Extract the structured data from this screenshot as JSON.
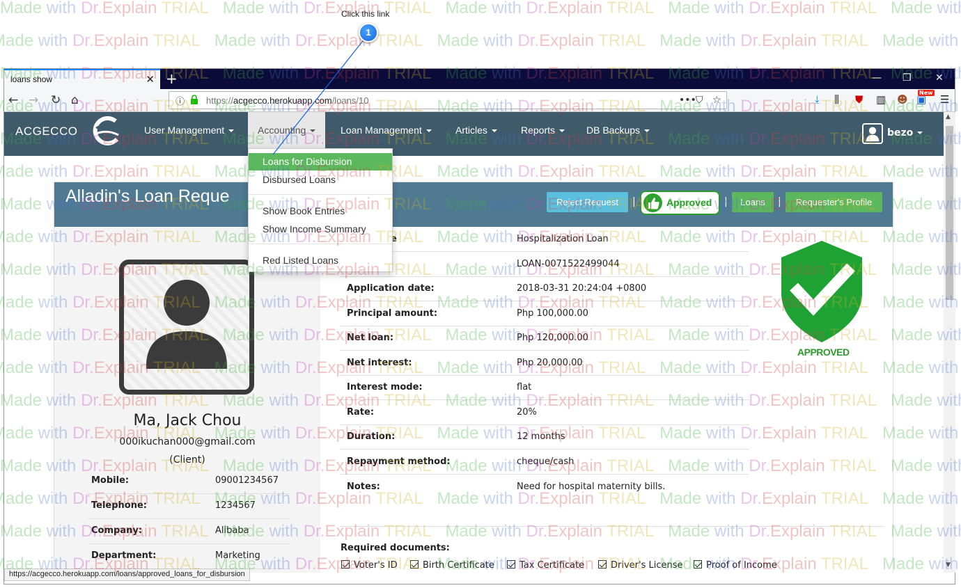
{
  "callout": {
    "text": "Click this link",
    "number": "1"
  },
  "watermark": {
    "made": "Made",
    "with": "with",
    "dr": "Dr.",
    "explain": "Explain",
    "trial": "TRIAL"
  },
  "browser": {
    "tab_title": "loans show",
    "url_prefix": "https://",
    "url_host": "acgecco.herokuapp.com",
    "url_path": "/loans/10",
    "status_url": "https://acgecco.herokuapp.com/loans/approved_loans_for_disbursion",
    "new_badge": "New"
  },
  "app": {
    "brand": "ACGECCO",
    "menu": [
      {
        "label": "User Management"
      },
      {
        "label": "Accounting"
      },
      {
        "label": "Loan Management"
      },
      {
        "label": "Articles"
      },
      {
        "label": "Reports"
      },
      {
        "label": "DB Backups"
      }
    ],
    "user": "bezo",
    "accounting_dropdown": [
      "Loans for Disbursion",
      "Disbursed Loans",
      "Show Book Entries",
      "Show Income Summary",
      "Red Listed Loans"
    ]
  },
  "panel": {
    "title": "Alladin's Loan Reque",
    "buttons": {
      "reject": "Reject Request",
      "approved": "Approved",
      "loans": "Loans",
      "profile": "Requester's Profile"
    },
    "separator": "|"
  },
  "client": {
    "name": "Ma, Jack Chou",
    "email": "000ikuchan000@gmail.com",
    "role": "(Client)",
    "details": [
      {
        "key": "Mobile:",
        "value": "09001234567"
      },
      {
        "key": "Telephone:",
        "value": "1234567"
      },
      {
        "key": "Company:",
        "value": "Alibaba"
      },
      {
        "key": "Department:",
        "value": "Marketing"
      }
    ]
  },
  "loan": {
    "rows": [
      {
        "key": "e",
        "value": "Hospitalization Loan"
      },
      {
        "key": "",
        "value": "LOAN-0071522499044"
      },
      {
        "key": "Application date:",
        "value": "2018-03-31 20:24:04 +0800"
      },
      {
        "key": "Principal amount:",
        "value": "Php 100,000.00"
      },
      {
        "key": "Net loan:",
        "value": "Php 120,000.00"
      },
      {
        "key": "Net interest:",
        "value": "Php 20,000.00"
      },
      {
        "key": "Interest mode:",
        "value": "flat"
      },
      {
        "key": "Rate:",
        "value": "20%"
      },
      {
        "key": "Duration:",
        "value": "12 months"
      },
      {
        "key": "Repayment method:",
        "value": "cheque/cash"
      },
      {
        "key": "Notes:",
        "value": "Need for hospital maternity bills."
      }
    ],
    "required_title": "Required documents:",
    "documents": [
      "Voter's ID",
      "Birth Certificate",
      "Tax Certificate",
      "Driver's License",
      "Proof of Income"
    ],
    "stamp_label": "APPROVED"
  },
  "colors": {
    "navbar": "#3f5a6b",
    "panel_head": "#4f7a92",
    "success": "#5cb85c",
    "info": "#5bc0de"
  }
}
